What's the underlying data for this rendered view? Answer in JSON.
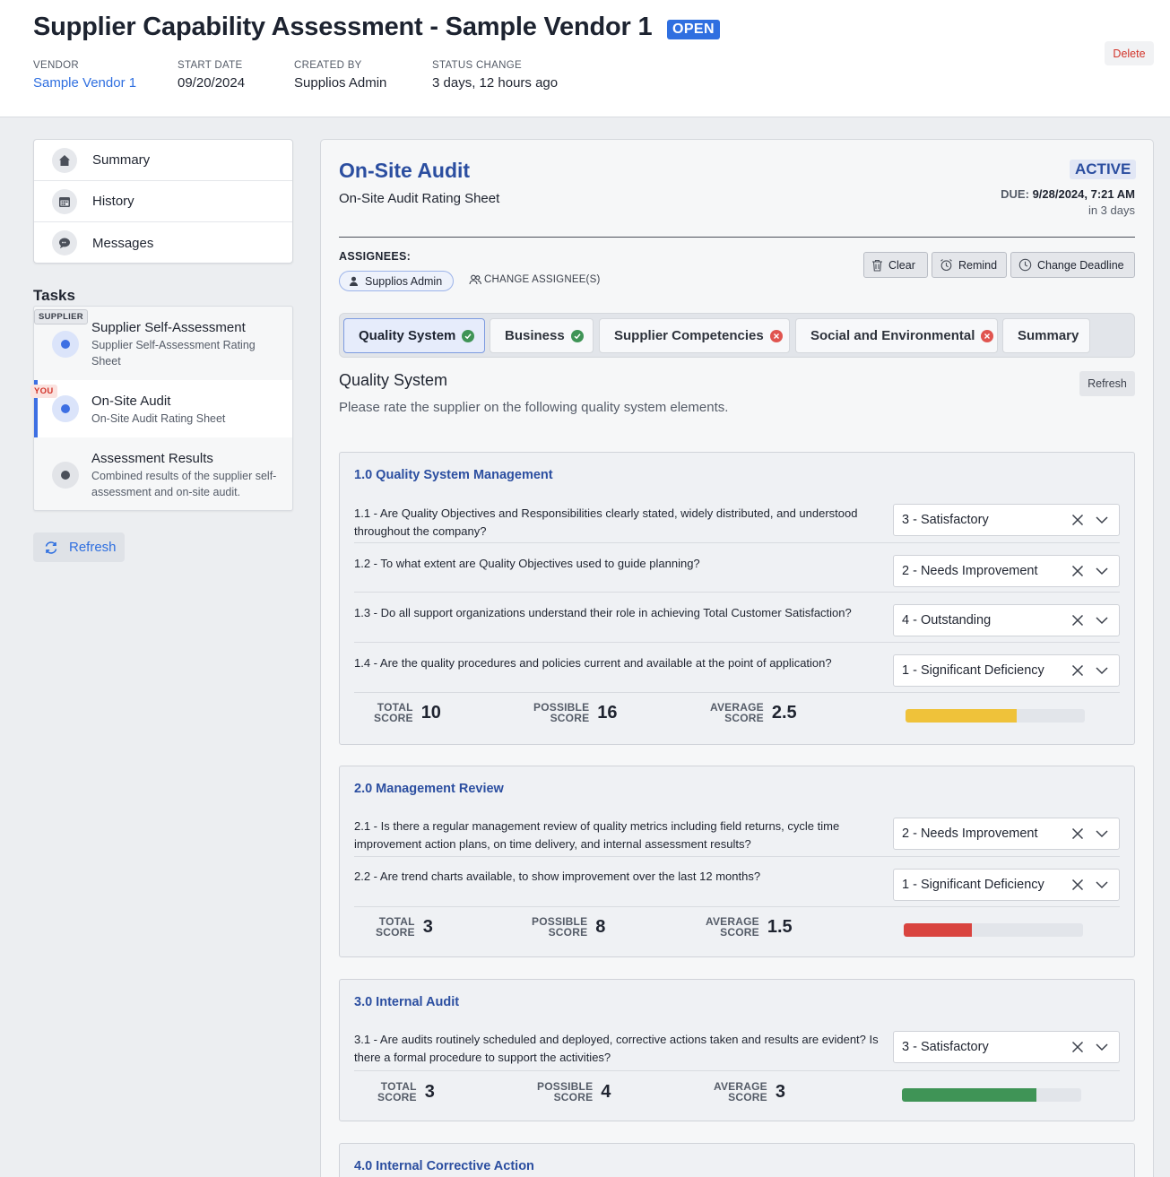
{
  "header": {
    "title": "Supplier Capability Assessment - Sample Vendor 1",
    "status_badge": "OPEN",
    "vendor_label": "VENDOR",
    "vendor_value": "Sample Vendor 1",
    "start_label": "START DATE",
    "start_value": "09/20/2024",
    "created_label": "CREATED BY",
    "created_value": "Supplios Admin",
    "status_change_label": "STATUS CHANGE",
    "status_change_value": "3 days, 12 hours ago",
    "delete_label": "Delete"
  },
  "nav": {
    "items": [
      {
        "label": "Summary",
        "icon": "house-icon"
      },
      {
        "label": "History",
        "icon": "calendar-icon"
      },
      {
        "label": "Messages",
        "icon": "chat-icon"
      }
    ]
  },
  "tasks": {
    "title": "Tasks",
    "items": [
      {
        "tag": "SUPPLIER",
        "title": "Supplier Self-Assessment",
        "subtitle": "Supplier Self-Assessment Rating Sheet"
      },
      {
        "tag": "YOU",
        "title": "On-Site Audit",
        "subtitle": "On-Site Audit Rating Sheet"
      },
      {
        "title": "Assessment Results",
        "subtitle": "Combined results of the supplier self-assessment and on-site audit."
      }
    ],
    "refresh_label": "Refresh"
  },
  "main": {
    "title": "On-Site Audit",
    "subtitle": "On-Site Audit Rating Sheet",
    "status": "ACTIVE",
    "due_label": "DUE:",
    "due_value": "9/28/2024, 7:21 AM",
    "due_relative": "in 3 days",
    "assignees_label": "ASSIGNEES:",
    "assignee": "Supplios Admin",
    "change_assignee": "CHANGE ASSIGNEE(S)",
    "actions": {
      "clear": "Clear",
      "remind": "Remind",
      "change_deadline": "Change Deadline"
    },
    "tabs": [
      {
        "label": "Quality System",
        "status": "complete"
      },
      {
        "label": "Business",
        "status": "complete"
      },
      {
        "label": "Supplier Competencies",
        "status": "incomplete"
      },
      {
        "label": "Social and Environmental",
        "status": "incomplete"
      },
      {
        "label": "Summary"
      }
    ],
    "section_title": "Quality System",
    "section_desc": "Please rate the supplier on the following quality system elements.",
    "section_refresh": "Refresh",
    "score_labels": {
      "total": [
        "TOTAL",
        "SCORE"
      ],
      "possible": [
        "POSSIBLE",
        "SCORE"
      ],
      "average": [
        "AVERAGE",
        "SCORE"
      ]
    },
    "groups": [
      {
        "title": "1.0 Quality System Management",
        "questions": [
          {
            "text": "1.1 - Are Quality Objectives and Responsibilities clearly stated, widely distributed, and understood throughout the company?",
            "answer": "3 - Satisfactory"
          },
          {
            "text": "1.2 - To what extent are Quality Objectives used to guide planning?",
            "answer": "2 - Needs Improvement"
          },
          {
            "text": "1.3 - Do all support organizations understand their role in achieving Total Customer Satisfaction?",
            "answer": "4 - Outstanding"
          },
          {
            "text": "1.4 - Are the quality procedures and policies current and available at the point of application?",
            "answer": "1 - Significant Deficiency"
          }
        ],
        "total": "10",
        "possible": "16",
        "average": "2.5",
        "bar_fraction": 0.62,
        "bar_color": "#efc23a"
      },
      {
        "title": "2.0 Management Review",
        "questions": [
          {
            "text": "2.1 - Is there a regular management review of quality metrics including field returns, cycle time improvement action plans, on time delivery, and internal assessment results?",
            "answer": "2 - Needs Improvement"
          },
          {
            "text": "2.2 - Are trend charts available, to show improvement over the last 12 months?",
            "answer": "1 - Significant Deficiency"
          }
        ],
        "total": "3",
        "possible": "8",
        "average": "1.5",
        "bar_fraction": 0.38,
        "bar_color": "#d9443f"
      },
      {
        "title": "3.0 Internal Audit",
        "questions": [
          {
            "text": "3.1 - Are audits routinely scheduled and deployed, corrective actions taken and results are evident? Is there a formal procedure to support the activities?",
            "answer": "3 - Satisfactory"
          }
        ],
        "total": "3",
        "possible": "4",
        "average": "3",
        "bar_fraction": 0.75,
        "bar_color": "#3f9456"
      },
      {
        "title": "4.0 Internal Corrective Action"
      }
    ]
  }
}
